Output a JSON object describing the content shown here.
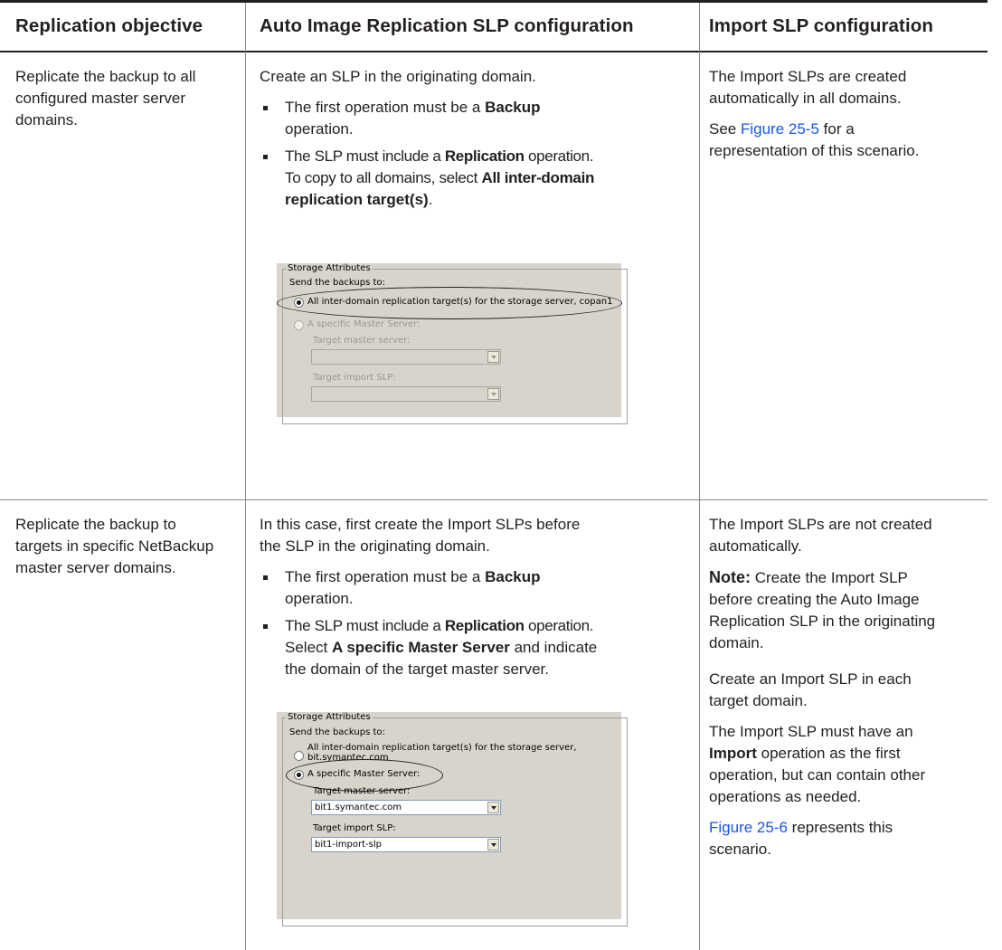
{
  "header": {
    "col1": "Replication objective",
    "col2": "Auto Image Replication SLP configuration",
    "col3": "Import SLP configuration"
  },
  "row1": {
    "objective": [
      "Replicate the backup to all",
      "configured master server",
      "domains."
    ],
    "intro": "Create an SLP in the originating domain.",
    "bullet1": {
      "pre": "The first operation must be a ",
      "bold": "Backup",
      "post": "operation."
    },
    "bullet2": {
      "pre": "The SLP must include a ",
      "bold": "Replication",
      "post": " operation.",
      "line2": "To copy to all domains, select ",
      "bold2": "All inter-domain",
      "bold3": "replication target(s)",
      "end": "."
    },
    "import": {
      "p1": [
        "The Import SLPs are created",
        "automatically in all domains."
      ],
      "see": "See ",
      "link": "Figure 25-5",
      "after_link": " for a",
      "p2_line2": "representation of this scenario."
    },
    "shot": {
      "group_title": "Storage Attributes",
      "send_label": "Send the backups to:",
      "option1": "All inter-domain replication target(s) for the storage server, copan1",
      "option2": "A specific Master Server:",
      "target_master_label": "Target master server:",
      "target_import_label": "Target import SLP:"
    }
  },
  "row2": {
    "objective": [
      "Replicate the backup to",
      "targets in specific NetBackup",
      "master server domains."
    ],
    "intro": [
      "In this case, first create the Import SLPs before",
      "the SLP in the originating domain."
    ],
    "bullet1": {
      "pre": "The first operation must be a ",
      "bold": "Backup",
      "post": "operation."
    },
    "bullet2": {
      "pre": "The SLP must include a ",
      "bold": "Replication",
      "post": " operation.",
      "l2_pre": "Select ",
      "l2_bold": "A specific Master Server",
      "l2_post": " and indicate",
      "l3": "the domain of the target master server."
    },
    "import": {
      "p1": [
        "The Import SLPs are not created",
        "automatically."
      ],
      "note_label": "Note:",
      "note_l1": " Create the Import SLP",
      "note_rest": [
        "before creating the Auto Image",
        "Replication SLP in the originating",
        "domain."
      ],
      "p3": [
        "Create an Import SLP in each",
        "target domain."
      ],
      "p4_l1": "The Import SLP must have an",
      "p4_bold": "Import",
      "p4_l2": " operation as the first",
      "p4_rest": [
        "operation, but can contain other",
        "operations as needed."
      ],
      "link": "Figure 25-6",
      "after_link": " represents this",
      "p5_l2": "scenario."
    },
    "shot": {
      "group_title": "Storage Attributes",
      "send_label": "Send the backups to:",
      "option1_l1": "All inter-domain replication target(s) for the storage server,",
      "option1_l2": "bit.symantec.com",
      "option2": "A specific Master Server:",
      "target_master_label": "Target master server:",
      "target_master_value": "bit1.symantec.com",
      "target_import_label": "Target import SLP:",
      "target_import_value": "bit1-import-slp"
    }
  }
}
